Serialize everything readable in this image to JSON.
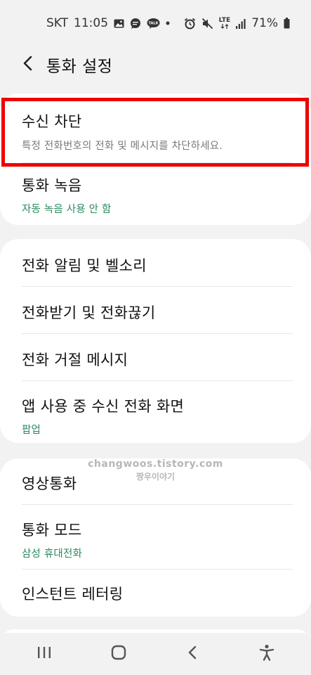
{
  "status_bar": {
    "carrier": "SKT",
    "time": "11:05",
    "notification_icons": [
      "gallery-icon",
      "chat-bubble-icon",
      "kakaotalk-icon",
      "dot-icon"
    ],
    "kakao_label": "TALK",
    "lte_label": "LTE",
    "battery": "71%",
    "right_icons": [
      "alarm-icon",
      "mute-icon",
      "lte-icon",
      "signal-icon",
      "battery-icon"
    ]
  },
  "header": {
    "title": "통화 설정"
  },
  "settings": {
    "call_blocking": {
      "title": "수신 차단",
      "subtitle": "특정 전화번호의 전화 및 메시지를 차단하세요."
    },
    "call_recording": {
      "title": "통화 녹음",
      "subtitle": "자동 녹음 사용 안 함"
    },
    "call_alerts": {
      "title": "전화 알림 및 벨소리"
    },
    "answer_end": {
      "title": "전화받기 및 전화끊기"
    },
    "reject_messages": {
      "title": "전화 거절 메시지"
    },
    "incoming_display": {
      "title": "앱 사용 중 수신 전화 화면",
      "subtitle": "팝업"
    },
    "video_call": {
      "title": "영상통화"
    },
    "call_mode": {
      "title": "통화 모드",
      "subtitle": "삼성 휴대전화"
    },
    "instant_lettering": {
      "title": "인스턴트 레터링"
    }
  },
  "watermark": {
    "line1": "changwoos.tistory.com",
    "line2": "짱우이야기"
  },
  "nav_bar": {
    "buttons": [
      "recent-apps-icon",
      "home-icon",
      "back-icon",
      "accessibility-icon"
    ]
  },
  "colors": {
    "background": "#f2f2f2",
    "card": "#ffffff",
    "accent_green": "#2b8a5f",
    "highlight_red": "#ee0000"
  }
}
